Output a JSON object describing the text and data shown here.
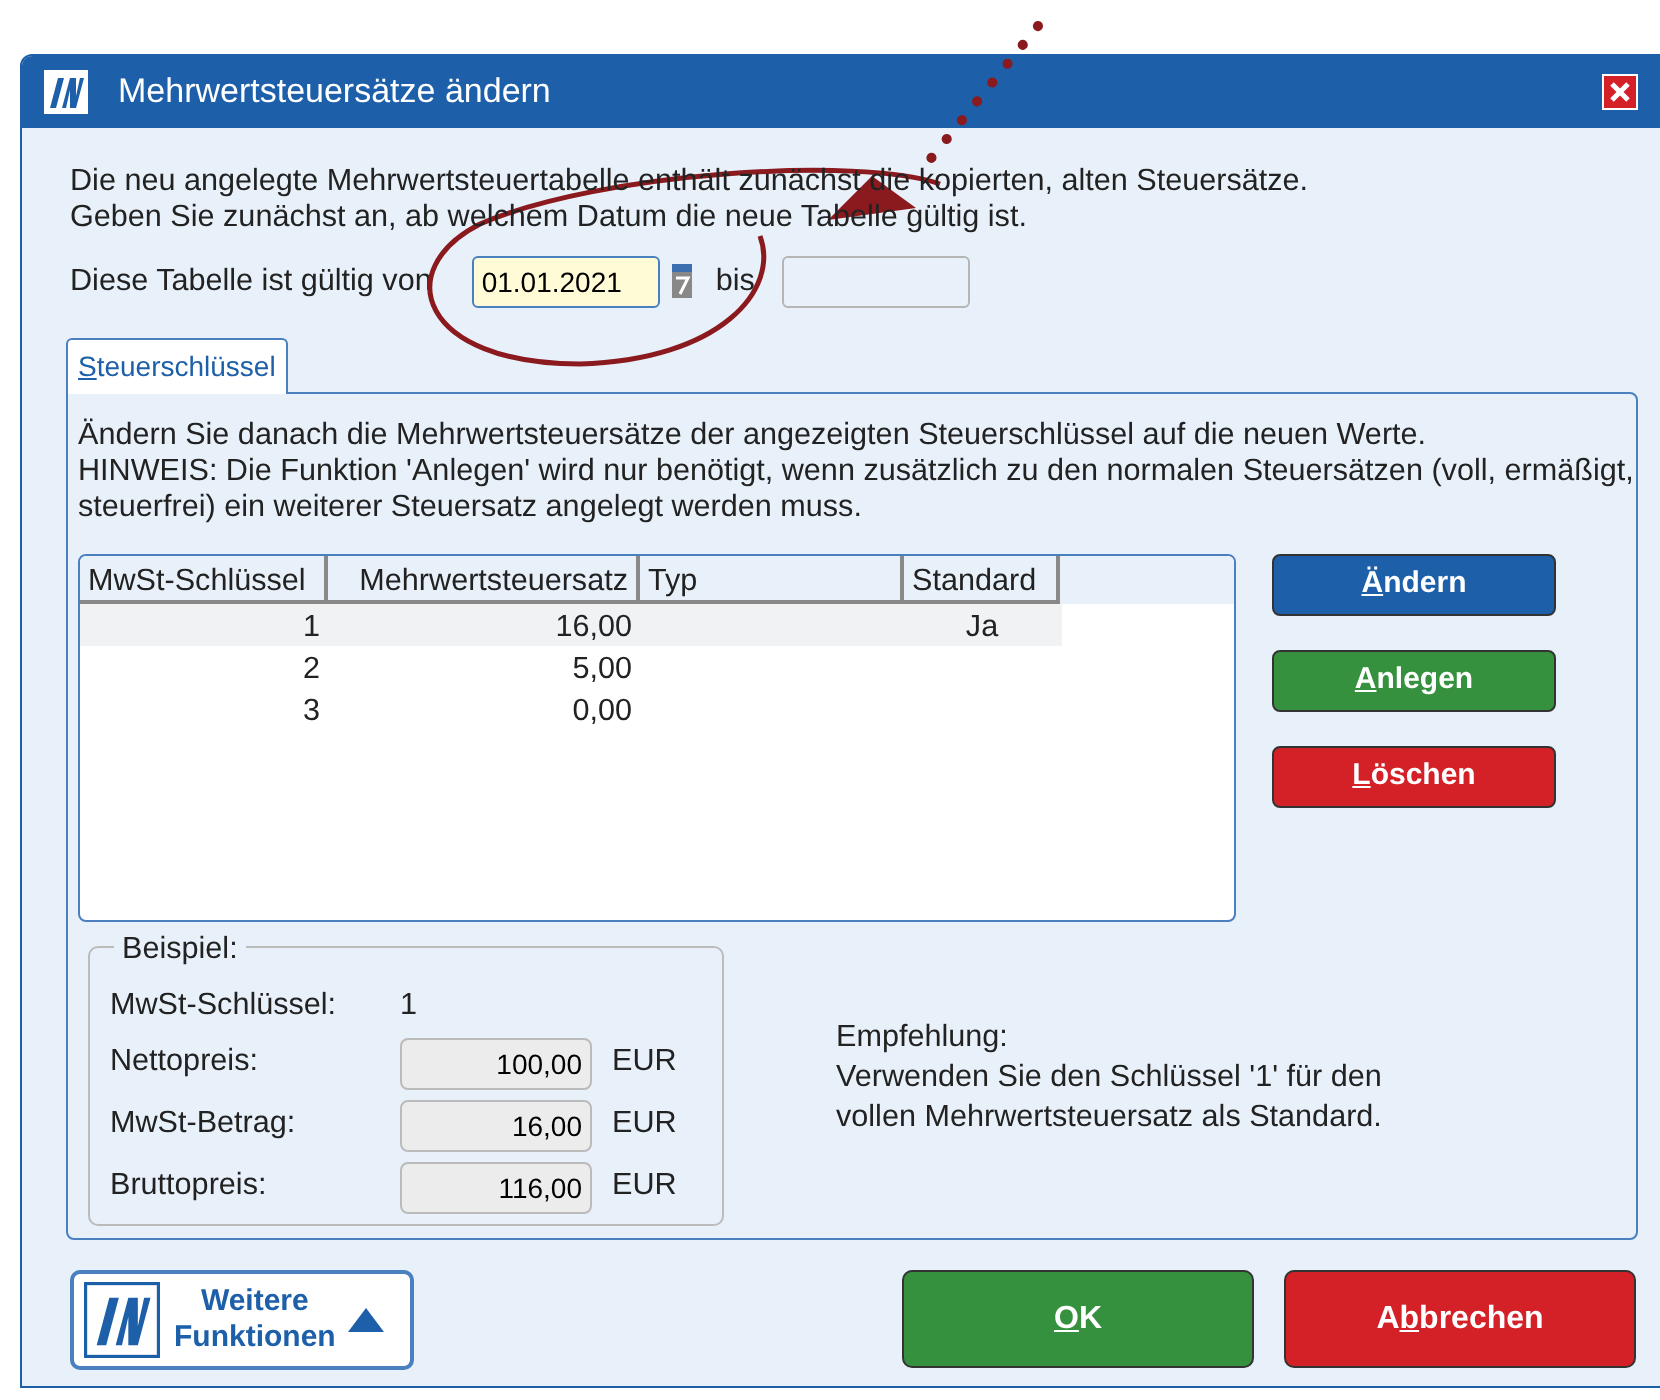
{
  "window": {
    "title": "Mehrwertsteuersätze ändern"
  },
  "intro": [
    "Die neu angelegte Mehrwertsteuertabelle enthält zunächst die kopierten, alten Steuersätze.",
    "Geben Sie zunächst an, ab welchem Datum die neue Tabelle gültig ist."
  ],
  "validity": {
    "label_from": "Diese Tabelle ist gültig von",
    "from_value": "01.01.2021",
    "label_to": "bis"
  },
  "tabs": [
    {
      "key": "S",
      "after": "teuerschlüssel",
      "selected": true
    }
  ],
  "panel_text": "Ändern Sie danach die Mehrwertsteuersätze der angezeigten Steuerschlüssel auf die neuen Werte.\nHINWEIS: Die Funktion 'Anlegen' wird nur benötigt, wenn zusätzlich zu den normalen Steuersätzen (voll, ermäßigt, steuerfrei) ein weiterer Steuersatz angelegt werden muss.",
  "table": {
    "columns": [
      "MwSt-Schlüssel",
      "Mehrwertsteuersatz",
      "Typ",
      "Standard"
    ],
    "rows": [
      {
        "cells": [
          "1",
          "16,00",
          "",
          "Ja"
        ],
        "selected": true
      },
      {
        "cells": [
          "2",
          "5,00",
          "",
          ""
        ],
        "selected": false
      },
      {
        "cells": [
          "3",
          "0,00",
          "",
          ""
        ],
        "selected": false
      }
    ]
  },
  "side_buttons": [
    {
      "key": "Ä",
      "after": "ndern",
      "color": "#1d5fa8"
    },
    {
      "key": "A",
      "after": "nlegen",
      "color": "#36913f"
    },
    {
      "key": "L",
      "after": "öschen",
      "color": "#d42027"
    }
  ],
  "example": {
    "title": "Beispiel:",
    "key_label": "MwSt-Schlüssel:",
    "key_value": "1",
    "rows": [
      {
        "label": "Nettopreis:",
        "value": "100,00",
        "unit": "EUR"
      },
      {
        "label": "MwSt-Betrag:",
        "value": "16,00",
        "unit": "EUR"
      },
      {
        "label": "Bruttopreis:",
        "value": "116,00",
        "unit": "EUR"
      }
    ]
  },
  "recommendation": [
    "Empfehlung:",
    "Verwenden Sie den Schlüssel '1' für den",
    "vollen Mehrwertsteuersatz als Standard."
  ],
  "more_button": {
    "lines": [
      "Weitere",
      "Funktionen"
    ]
  },
  "footer_buttons": [
    {
      "key": "O",
      "after": "K",
      "color": "#36913f"
    },
    {
      "before": "A",
      "key": "b",
      "after": "brechen",
      "color": "#d42027"
    }
  ]
}
